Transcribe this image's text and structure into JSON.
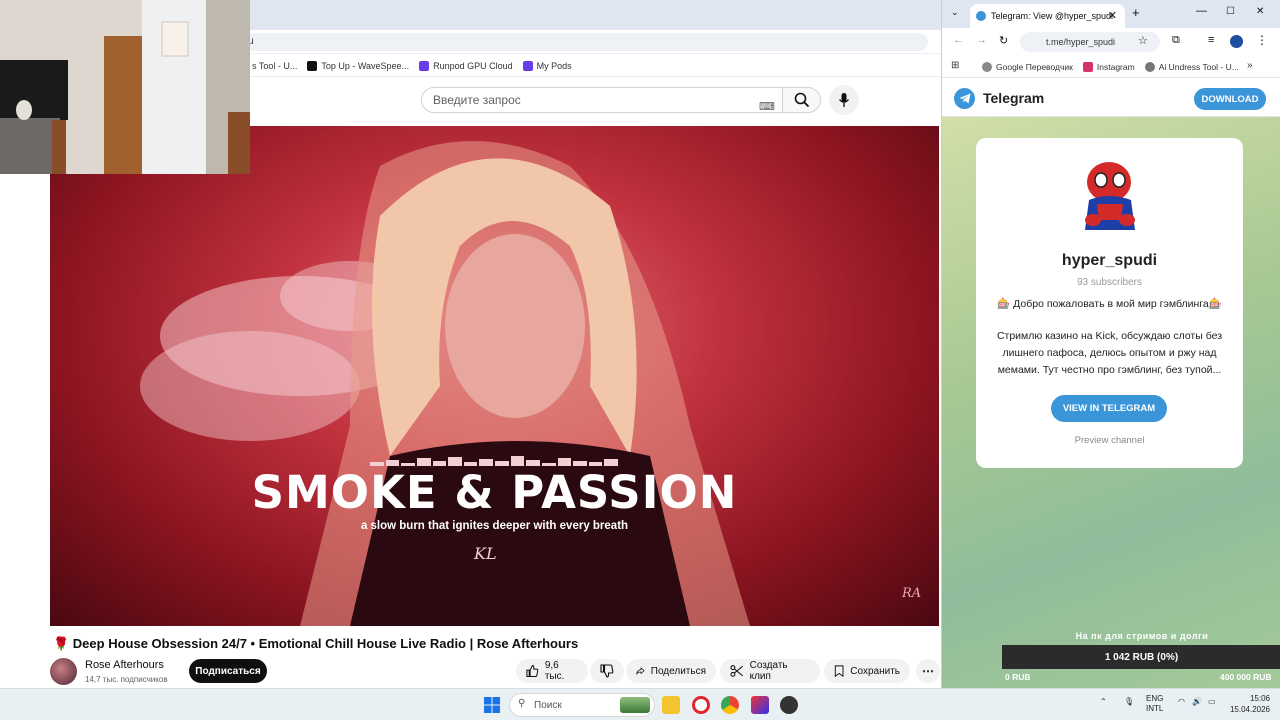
{
  "left_browser": {
    "address_fragment": "u",
    "bookmarks": [
      {
        "label": "s Tool - U...",
        "color": "#777777"
      },
      {
        "label": "Top Up - WaveSpee...",
        "color": "#111111"
      },
      {
        "label": "Runpod GPU Cloud",
        "color": "#6a3de8"
      },
      {
        "label": "My Pods",
        "color": "#6a3de8"
      }
    ]
  },
  "youtube": {
    "search_placeholder": "Введите запрос",
    "video": {
      "overlay_title": "SMOKE & PASSION",
      "overlay_subtitle": "a slow burn that ignites deeper with every breath",
      "signature": "KL",
      "watermark": "RA"
    },
    "title": "🌹 Deep House Obsession 24/7 • Emotional Chill House Live Radio | Rose Afterhours",
    "channel_name": "Rose Afterhours",
    "subscribers": "14,7 тыс. подписчиков",
    "subscribe_label": "Подписаться",
    "likes": "9,6 тыс.",
    "share_label": "Поделиться",
    "clip_label": "Создать клип",
    "save_label": "Сохранить",
    "more_label": "⋯"
  },
  "right_browser": {
    "tab_title": "Telegram: View @hyper_spudi",
    "url": "t.me/hyper_spudi",
    "bookmarks": [
      {
        "label": "Google Переводчик"
      },
      {
        "label": "Instagram"
      },
      {
        "label": "Ai Undress Tool - U..."
      }
    ]
  },
  "telegram": {
    "brand": "Telegram",
    "download_label": "DOWNLOAD",
    "channel_name": "hyper_spudi",
    "subscribers": "93 subscribers",
    "greeting": "🎰 Добро пожаловать в мой мир гэмблинга🎰",
    "description": "Стримлю казино на Kick, обсуждаю слоты без лишнего пафоса, делюсь опытом и ржу над мемами. Тут честно про гэмблинг, без тупой...",
    "view_button": "VIEW IN TELEGRAM",
    "preview_link": "Preview channel",
    "accent_color": "#3a95d9"
  },
  "donation_goal": {
    "caption": "На пк для стримов и долги",
    "current": "1 042 RUB (0%)",
    "min": "0 RUB",
    "max": "400 000 RUB",
    "progress_percent": 0
  },
  "taskbar": {
    "search_placeholder": "Поиск",
    "language": "ENG",
    "layout": "INTL",
    "time": "15:06",
    "date": "15.04.2026"
  }
}
